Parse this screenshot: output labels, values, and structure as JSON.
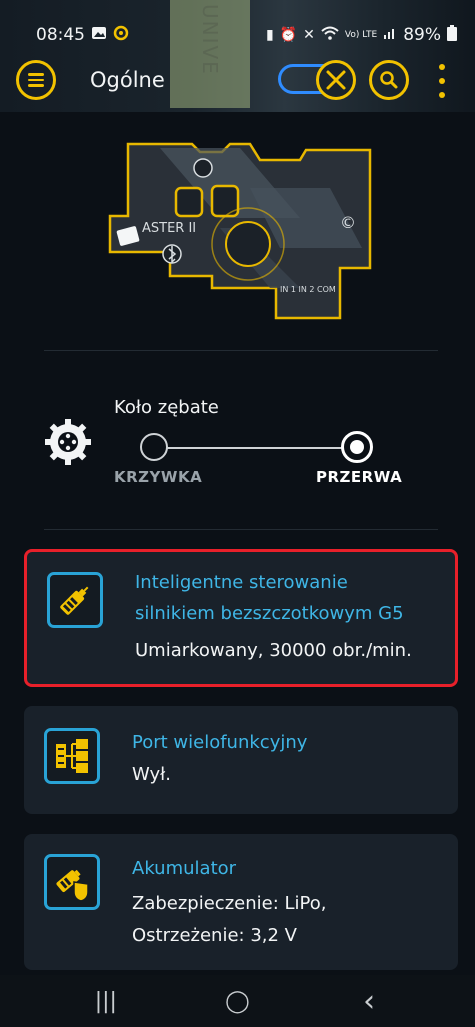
{
  "status_bar": {
    "time": "08:45",
    "network_label": "Vo) LTE",
    "battery": "89%"
  },
  "app_bar": {
    "title": "Ogólne",
    "background_text": "UNIVE"
  },
  "board": {
    "brand": "ASTER II",
    "port_labels": "IN 1  IN 2  COM",
    "copyright_mark": "©"
  },
  "gear": {
    "title": "Koło zębate",
    "option_left": "KRZYWKA",
    "option_right": "PRZERWA",
    "selected": "PRZERWA"
  },
  "cards": [
    {
      "title_line1": "Inteligentne sterowanie",
      "title_line2": "silnikiem bezszczotkowym G5",
      "value_line1": "Umiarkowany, 30000 obr./min.",
      "icon": "motor-icon",
      "highlighted": true
    },
    {
      "title_line1": "Port wielofunkcyjny",
      "value_line1": "Wył.",
      "icon": "port-tree-icon",
      "highlighted": false
    },
    {
      "title_line1": "Akumulator",
      "value_line1": "Zabezpieczenie: LiPo,",
      "value_line2": "Ostrzeżenie: 3,2 V",
      "icon": "battery-shield-icon",
      "highlighted": false
    }
  ],
  "nav": {
    "recents": "|||",
    "home": "◯",
    "back": "‹"
  },
  "colors": {
    "accent_yellow": "#f2c200",
    "accent_blue": "#29a3d6",
    "highlight_red": "#e8202a",
    "background": "#0b1016",
    "card": "#19212a"
  }
}
